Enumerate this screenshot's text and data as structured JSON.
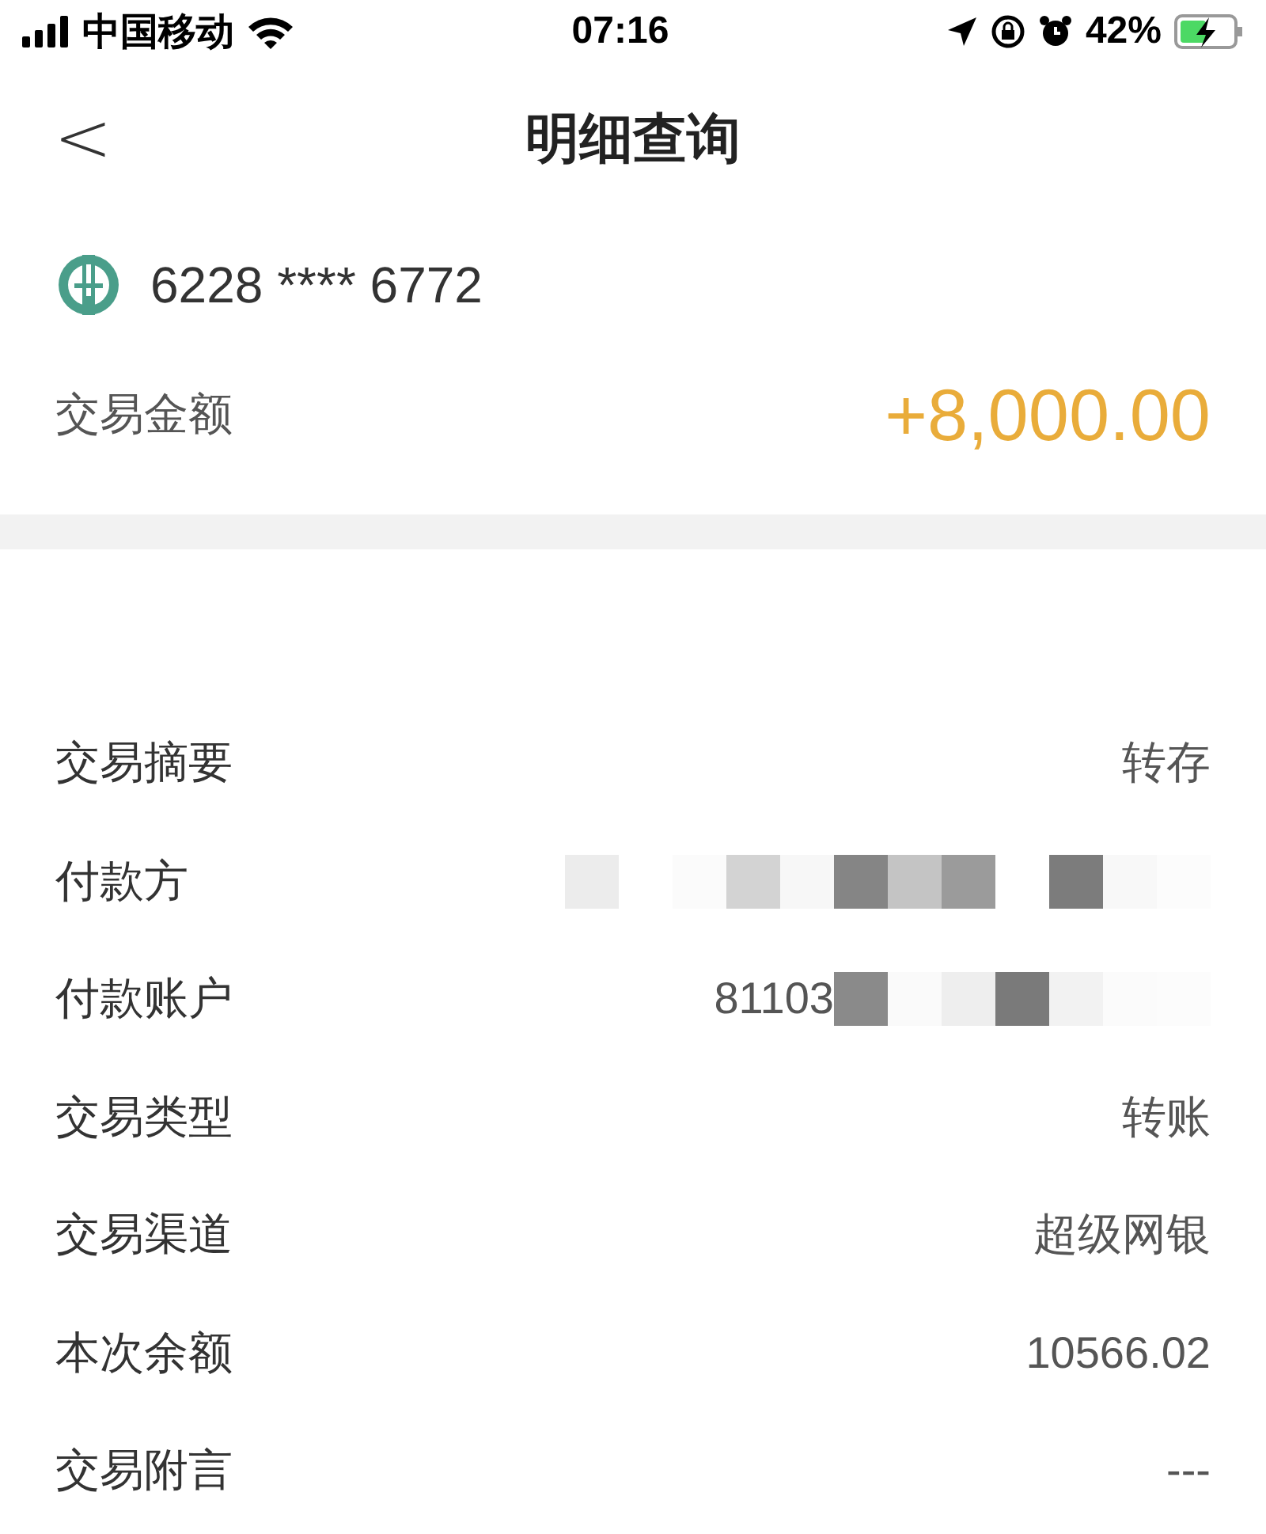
{
  "status_bar": {
    "carrier": "中国移动",
    "time": "07:16",
    "battery": "42%"
  },
  "nav": {
    "back": "<",
    "title": "明细查询"
  },
  "account": {
    "number": "6228 **** 6772"
  },
  "amount": {
    "label": "交易金额",
    "value": "+8,000.00"
  },
  "details": [
    {
      "label": "交易摘要",
      "value": "转存",
      "kind": "text"
    },
    {
      "label": "付款方",
      "kind": "redacted"
    },
    {
      "label": "付款账户",
      "value": "81103",
      "kind": "partly_redacted"
    },
    {
      "label": "交易类型",
      "value": "转账",
      "kind": "text"
    },
    {
      "label": "交易渠道",
      "value": "超级网银",
      "kind": "text"
    },
    {
      "label": "本次余额",
      "value": "10566.02",
      "kind": "text"
    },
    {
      "label": "交易附言",
      "value": "---",
      "kind": "text"
    }
  ]
}
